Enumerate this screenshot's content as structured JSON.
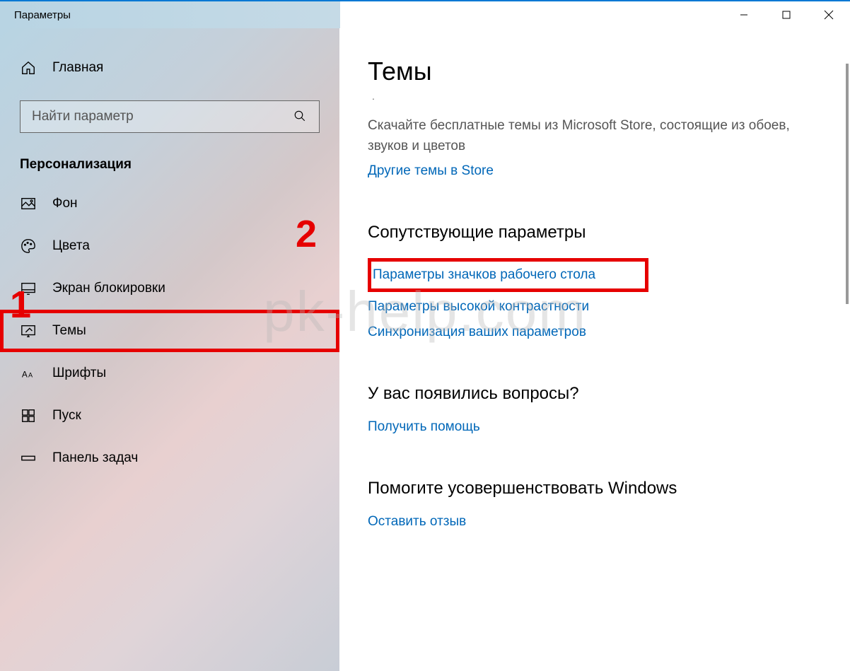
{
  "titlebar": {
    "title": "Параметры"
  },
  "sidebar": {
    "home_label": "Главная",
    "search_placeholder": "Найти параметр",
    "category": "Персонализация",
    "items": [
      {
        "label": "Фон",
        "icon": "image-icon"
      },
      {
        "label": "Цвета",
        "icon": "palette-icon"
      },
      {
        "label": "Экран блокировки",
        "icon": "lock-screen-icon"
      },
      {
        "label": "Темы",
        "icon": "themes-icon",
        "highlighted": true
      },
      {
        "label": "Шрифты",
        "icon": "fonts-icon"
      },
      {
        "label": "Пуск",
        "icon": "start-icon"
      },
      {
        "label": "Панель задач",
        "icon": "taskbar-icon"
      }
    ]
  },
  "content": {
    "page_title": "Темы",
    "description": "Скачайте бесплатные темы из Microsoft Store, состоящие из обоев, звуков и цветов",
    "store_link": "Другие темы в Store",
    "related": {
      "title": "Сопутствующие параметры",
      "links": [
        {
          "label": "Параметры значков рабочего стола",
          "highlighted": true
        },
        {
          "label": "Параметры высокой контрастности"
        },
        {
          "label": "Синхронизация ваших параметров"
        }
      ]
    },
    "questions": {
      "title": "У вас появились вопросы?",
      "link": "Получить помощь"
    },
    "feedback": {
      "title": "Помогите усовершенствовать Windows",
      "link": "Оставить отзыв"
    }
  },
  "annotations": {
    "one": "1",
    "two": "2"
  },
  "watermark": "pk-help.com"
}
